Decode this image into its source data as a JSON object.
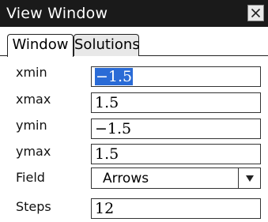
{
  "window": {
    "title": "View Window",
    "close_icon": "close-icon"
  },
  "tabs": [
    {
      "label": "Window",
      "active": true
    },
    {
      "label": "Solutions",
      "active": false
    }
  ],
  "fields": {
    "xmin": {
      "label": "xmin",
      "value": "−1.5",
      "selected": true
    },
    "xmax": {
      "label": "xmax",
      "value": "1.5"
    },
    "ymin": {
      "label": "ymin",
      "value": "−1.5"
    },
    "ymax": {
      "label": "ymax",
      "value": "1.5"
    },
    "field": {
      "label": "Field",
      "value": "Arrows",
      "dropdown_icon": "chevron-down-icon"
    },
    "steps": {
      "label": "Steps",
      "value": "12"
    }
  },
  "colors": {
    "titlebar": "#1a1a1a",
    "selection": "#2a6bd6",
    "inactive_tab": "#e8e8e8"
  }
}
